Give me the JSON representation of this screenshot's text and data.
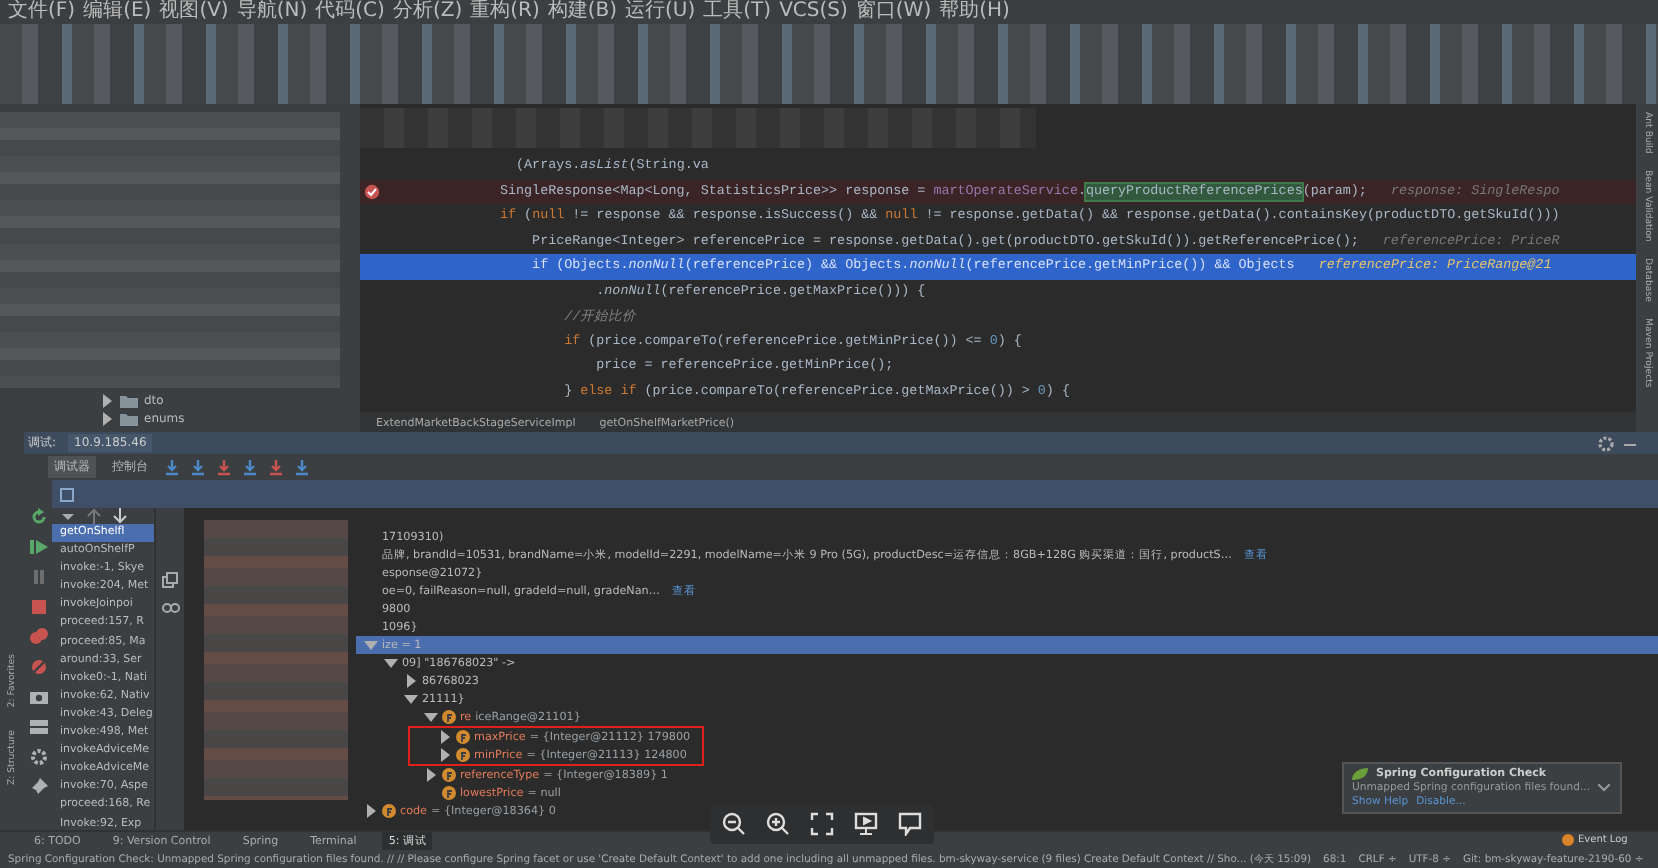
{
  "menu": [
    "文件(F)",
    "编辑(E)",
    "视图(V)",
    "导航(N)",
    "代码(C)",
    "分析(Z)",
    "重构(R)",
    "构建(B)",
    "运行(U)",
    "工具(T)",
    "VCS(S)",
    "窗口(W)",
    "帮助(H)"
  ],
  "project_tree": [
    {
      "label": "dto",
      "expanded": false
    },
    {
      "label": "enums",
      "expanded": false
    }
  ],
  "editor": {
    "lines": [
      {
        "breakpoint": false,
        "current": false,
        "segments": [
          {
            "kind": "plain",
            "text": "  (Arrays."
          },
          {
            "kind": "static",
            "text": "asList"
          },
          {
            "kind": "plain",
            "text": "(String.va"
          }
        ]
      },
      {
        "breakpoint": true,
        "current": false,
        "segments": [
          {
            "kind": "plain",
            "text": "SingleResponse<Map<Long, StatisticsPrice>> response = "
          },
          {
            "kind": "field",
            "text": "martOperateService"
          },
          {
            "kind": "plain",
            "text": "."
          },
          {
            "kind": "match",
            "text": "queryProductReferencePrices"
          },
          {
            "kind": "plain",
            "text": "(param);"
          }
        ],
        "hint": "response: SingleRespo"
      },
      {
        "breakpoint": false,
        "current": false,
        "segments": [
          {
            "kind": "keyword",
            "text": "if"
          },
          {
            "kind": "plain",
            "text": " ("
          },
          {
            "kind": "keyword",
            "text": "null"
          },
          {
            "kind": "plain",
            "text": " != response && response.isSuccess() && "
          },
          {
            "kind": "keyword",
            "text": "null"
          },
          {
            "kind": "plain",
            "text": " != response.getData() && response.getData().containsKey(productDTO.getSkuId()))"
          }
        ]
      },
      {
        "breakpoint": false,
        "current": false,
        "segments": [
          {
            "kind": "plain",
            "text": "    PriceRange<Integer> referencePrice = response.getData().get(productDTO.getSkuId()).getReferencePrice();"
          }
        ],
        "hint": "referencePrice: PriceR"
      },
      {
        "breakpoint": false,
        "current": true,
        "segments": [
          {
            "kind": "plain",
            "text": "    if (Objects."
          },
          {
            "kind": "static",
            "text": "nonNull"
          },
          {
            "kind": "plain",
            "text": "(referencePrice) && Objects."
          },
          {
            "kind": "static",
            "text": "nonNull"
          },
          {
            "kind": "plain",
            "text": "(referencePrice.getMinPrice()) && Objects"
          }
        ],
        "hint": "referencePrice: PriceRange@21"
      },
      {
        "breakpoint": false,
        "current": false,
        "segments": [
          {
            "kind": "plain",
            "text": "            ."
          },
          {
            "kind": "static",
            "text": "nonNull"
          },
          {
            "kind": "plain",
            "text": "(referencePrice.getMaxPrice())) {"
          }
        ]
      },
      {
        "breakpoint": false,
        "current": false,
        "segments": [
          {
            "kind": "comment",
            "text": "        //开始比价"
          }
        ]
      },
      {
        "breakpoint": false,
        "current": false,
        "segments": [
          {
            "kind": "keyword",
            "text": "        if"
          },
          {
            "kind": "plain",
            "text": " (price.compareTo(referencePrice.getMinPrice()) <= "
          },
          {
            "kind": "number",
            "text": "0"
          },
          {
            "kind": "plain",
            "text": ") {"
          }
        ]
      },
      {
        "breakpoint": false,
        "current": false,
        "segments": [
          {
            "kind": "plain",
            "text": "            price = referencePrice.getMinPrice();"
          }
        ]
      },
      {
        "breakpoint": false,
        "current": false,
        "segments": [
          {
            "kind": "plain",
            "text": "        } "
          },
          {
            "kind": "keyword",
            "text": "else if"
          },
          {
            "kind": "plain",
            "text": " (price.compareTo(referencePrice.getMaxPrice()) > "
          },
          {
            "kind": "number",
            "text": "0"
          },
          {
            "kind": "plain",
            "text": ") {"
          }
        ]
      }
    ],
    "breadcrumbs": [
      "ExtendMarketBackStageServiceImpl",
      "getOnShelfMarketPrice()"
    ]
  },
  "right_tools": [
    "Ant Build",
    "Bean Validation",
    "Database",
    "Maven Projects"
  ],
  "left_tools": [
    "Z: Structure",
    "2: Favorites"
  ],
  "debug": {
    "title": "调试:",
    "session": "10.9.185.46",
    "tabs": [
      {
        "label": "调试器",
        "selected": true
      },
      {
        "label": "控制台",
        "selected": false
      }
    ],
    "frames": [
      {
        "label": "getOnShelfl",
        "selected": true
      },
      {
        "label": "autoOnShelfP",
        "selected": false
      },
      {
        "label": "invoke:-1, Skye",
        "selected": false
      },
      {
        "label": "invoke:204, Met",
        "selected": false
      },
      {
        "label": "invokeJoinpoi",
        "selected": false
      },
      {
        "label": "proceed:157, R",
        "selected": false
      },
      {
        "label": "proceed:85, Ma",
        "selected": false
      },
      {
        "label": "around:33, Ser",
        "selected": false
      },
      {
        "label": "invoke0:-1, Nati",
        "selected": false
      },
      {
        "label": "invoke:62, Nativ",
        "selected": false
      },
      {
        "label": "invoke:43, Deleg",
        "selected": false
      },
      {
        "label": "invoke:498, Met",
        "selected": false
      },
      {
        "label": "invokeAdviceMe",
        "selected": false
      },
      {
        "label": "invokeAdviceMe",
        "selected": false
      },
      {
        "label": "invoke:70, Aspe",
        "selected": false
      },
      {
        "label": "proceed:168, Re",
        "selected": false
      },
      {
        "label": "Invoke:92, Exp",
        "selected": false
      }
    ],
    "variables": [
      {
        "text": "17109310)",
        "selected": false
      },
      {
        "text": "品牌, brandId=10531, brandName=小米, modelId=2291, modelName=小米 9 Pro (5G), productDesc=运存信息：8GB+128G 购买渠道：国行, productS…",
        "link": "查看",
        "selected": false
      },
      {
        "text": "esponse@21072}",
        "selected": false
      },
      {
        "text": "oe=0, failReason=null, gradeId=null, gradeNan…",
        "link": "查看",
        "selected": false
      },
      {
        "text": "9800",
        "selected": false
      },
      {
        "text": "1096}",
        "selected": false
      },
      {
        "text": "ize = 1",
        "selected": true,
        "expanded": true,
        "children": [
          {
            "text": "09] \"186768023\" ->",
            "selected": false,
            "expanded": true,
            "children": [
              {
                "text": "86768023",
                "selected": false,
                "expanded": false
              },
              {
                "text": "21111}",
                "selected": false,
                "expanded": true,
                "children": [
                  {
                    "name": "re",
                    "value": "iceRange@21101}",
                    "selected": false,
                    "expanded": true,
                    "boxed_children": true,
                    "children": [
                      {
                        "name": "maxPrice",
                        "value": "= {Integer@21112} 179800",
                        "selected": false,
                        "expanded": false
                      },
                      {
                        "name": "minPrice",
                        "value": "= {Integer@21113} 124800",
                        "selected": false,
                        "expanded": false
                      }
                    ]
                  },
                  {
                    "name": "referenceType",
                    "value": "= {Integer@18389} 1",
                    "selected": false,
                    "expanded": false
                  },
                  {
                    "name": "lowestPrice",
                    "value": "= null",
                    "selected": false
                  }
                ]
              }
            ]
          }
        ]
      },
      {
        "name": "code",
        "value": "= {Integer@18364} 0",
        "selected": false,
        "expanded": false
      }
    ]
  },
  "bottom_tabs": [
    {
      "label": "6: TODO",
      "selected": false
    },
    {
      "label": "9: Version Control",
      "selected": false
    },
    {
      "label": "Spring",
      "selected": false
    },
    {
      "label": "Terminal",
      "selected": false
    },
    {
      "label": "5: 调试",
      "selected": true
    }
  ],
  "notification": {
    "title": "Spring Configuration Check",
    "message": "Unmapped Spring configuration files found...",
    "actions": [
      "Show Help",
      "Disable..."
    ]
  },
  "event_log": "Event Log",
  "status_bar": {
    "message": "Spring Configuration Check: Unmapped Spring configuration files found. // // Please configure Spring facet or use 'Create Default Context' to add one including all unmapped files. bm-skyway-service (9 files)  Create Default Context // Sho... (今天 15:09)",
    "items": [
      "68:1",
      "CRLF ÷",
      "UTF-8 ÷",
      "Git: bm-skyway-feature-2190-60 ÷"
    ]
  }
}
